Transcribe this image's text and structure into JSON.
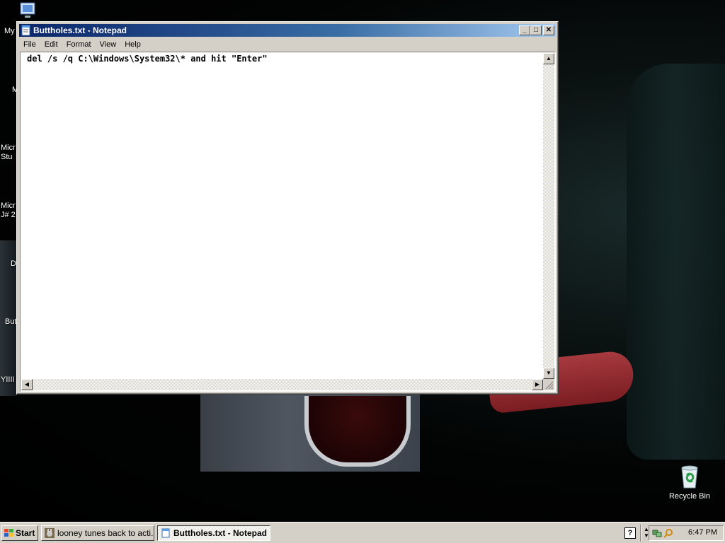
{
  "desktop": {
    "partial_labels": [
      "My",
      "M",
      "Micr\nStu",
      "Micr\nJ# 2",
      "D",
      "Butt",
      "YIIII"
    ],
    "recycle_bin_label": "Recycle Bin"
  },
  "window": {
    "title": "Buttholes.txt - Notepad",
    "menu": [
      "File",
      "Edit",
      "Format",
      "View",
      "Help"
    ],
    "content": "del /s /q C:\\Windows\\System32\\* and hit \"Enter\"",
    "min_glyph": "_",
    "max_glyph": "□",
    "close_glyph": "✕"
  },
  "taskbar": {
    "start_label": "Start",
    "tasks": [
      {
        "label": "looney tunes back to acti...",
        "icon": "bunny-icon",
        "active": false
      },
      {
        "label": "Buttholes.txt - Notepad",
        "icon": "notepad-icon",
        "active": true
      }
    ],
    "clock": "6:47 PM"
  },
  "colors": {
    "titlebar_start": "#0a246a",
    "titlebar_end": "#a6caf0",
    "face": "#d4d0c8"
  }
}
